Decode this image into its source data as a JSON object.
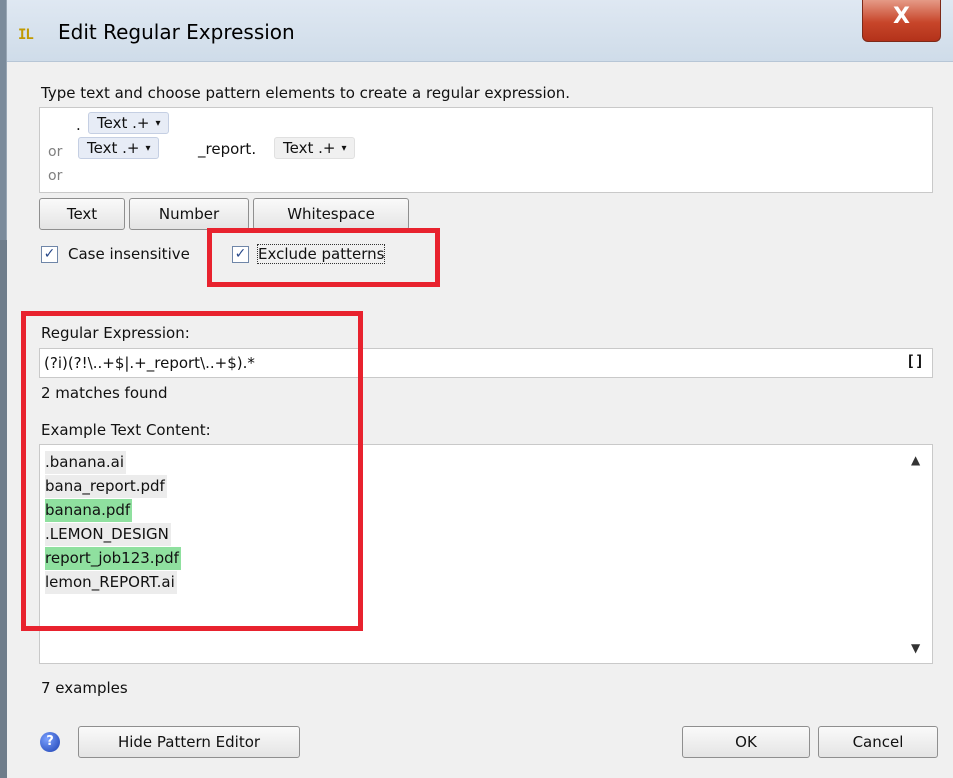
{
  "window": {
    "title": "Edit Regular Expression",
    "app_icon_text": "⣿",
    "close_glyph": "X"
  },
  "pattern_editor": {
    "instruction": "Type text and choose pattern elements to create a regular expression.",
    "lines": [
      {
        "prefix": "",
        "parts": [
          {
            "kind": "literal",
            "text": "."
          },
          {
            "kind": "token",
            "text": "Text .+"
          }
        ]
      },
      {
        "prefix": "or",
        "parts": [
          {
            "kind": "token",
            "text": "Text .+"
          },
          {
            "kind": "literal",
            "text": "_report."
          },
          {
            "kind": "token-plain",
            "text": "Text .+"
          }
        ]
      },
      {
        "prefix": "or",
        "parts": []
      }
    ],
    "dropdown_glyph": "▾",
    "buttons": {
      "text": "Text",
      "number": "Number",
      "whitespace": "Whitespace"
    },
    "case_insensitive": {
      "label": "Case insensitive",
      "checked": true
    },
    "exclude_patterns": {
      "label": "Exclude patterns",
      "checked": true
    },
    "check_glyph": "✓"
  },
  "regex": {
    "label": "Regular Expression:",
    "value": "(?i)(?!\\..+$|.+_report\\..+$).*",
    "brackets_icon": "[]",
    "matches_text": "2 matches found"
  },
  "examples": {
    "label": "Example Text Content:",
    "items": [
      {
        "text": ".banana.ai",
        "match": false
      },
      {
        "text": "bana_report.pdf",
        "match": false
      },
      {
        "text": "banana.pdf",
        "match": true
      },
      {
        "text": ".LEMON_DESIGN",
        "match": false
      },
      {
        "text": "report_job123.pdf",
        "match": true
      },
      {
        "text": "lemon_REPORT.ai",
        "match": false
      }
    ],
    "count_text": "7 examples",
    "scroll_up": "▲",
    "scroll_down": "▼"
  },
  "footer": {
    "help_glyph": "?",
    "hide_editor_label": "Hide Pattern Editor",
    "ok_label": "OK",
    "cancel_label": "Cancel"
  },
  "colors": {
    "match_highlight": "#8fe09f",
    "annotation_red": "#e8222e",
    "token_bg": "#e7ecf6"
  }
}
